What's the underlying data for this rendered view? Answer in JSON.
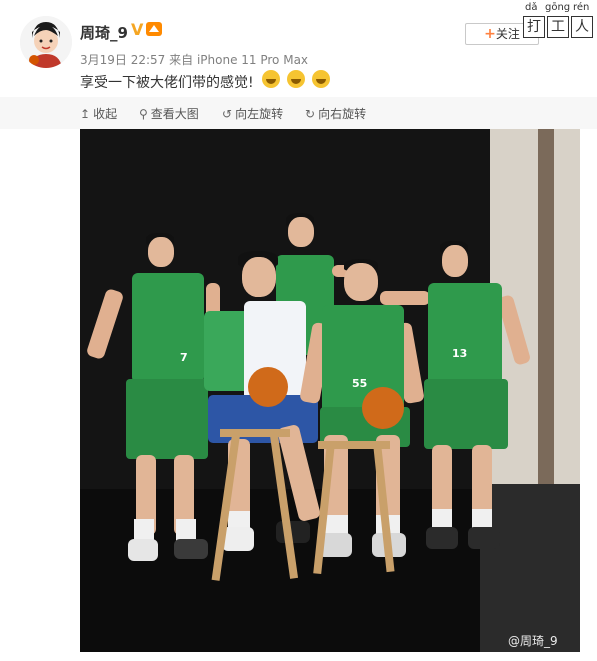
{
  "post": {
    "username": "周琦_9",
    "verified_mark": "V",
    "level_badge": "",
    "timestamp": "3月19日 22:57",
    "source": "来自 iPhone 11 Pro Max",
    "text": "享受一下被大佬们带的感觉!",
    "emoji_count": 3
  },
  "header": {
    "follow_label": "关注",
    "follow_icon": "plus-icon"
  },
  "pinyin": {
    "items": [
      {
        "pinyin": "dǎ",
        "hanzi": "打"
      },
      {
        "pinyin": "gōng",
        "hanzi": "工"
      },
      {
        "pinyin": "rén",
        "hanzi": "人"
      }
    ]
  },
  "toolbar": {
    "collapse": "收起",
    "view_large": "查看大图",
    "rotate_left": "向左旋转",
    "rotate_right": "向右旋转"
  },
  "image": {
    "watermark": "@周琦_9",
    "jersey_numbers": [
      "7",
      "13",
      "55"
    ]
  }
}
